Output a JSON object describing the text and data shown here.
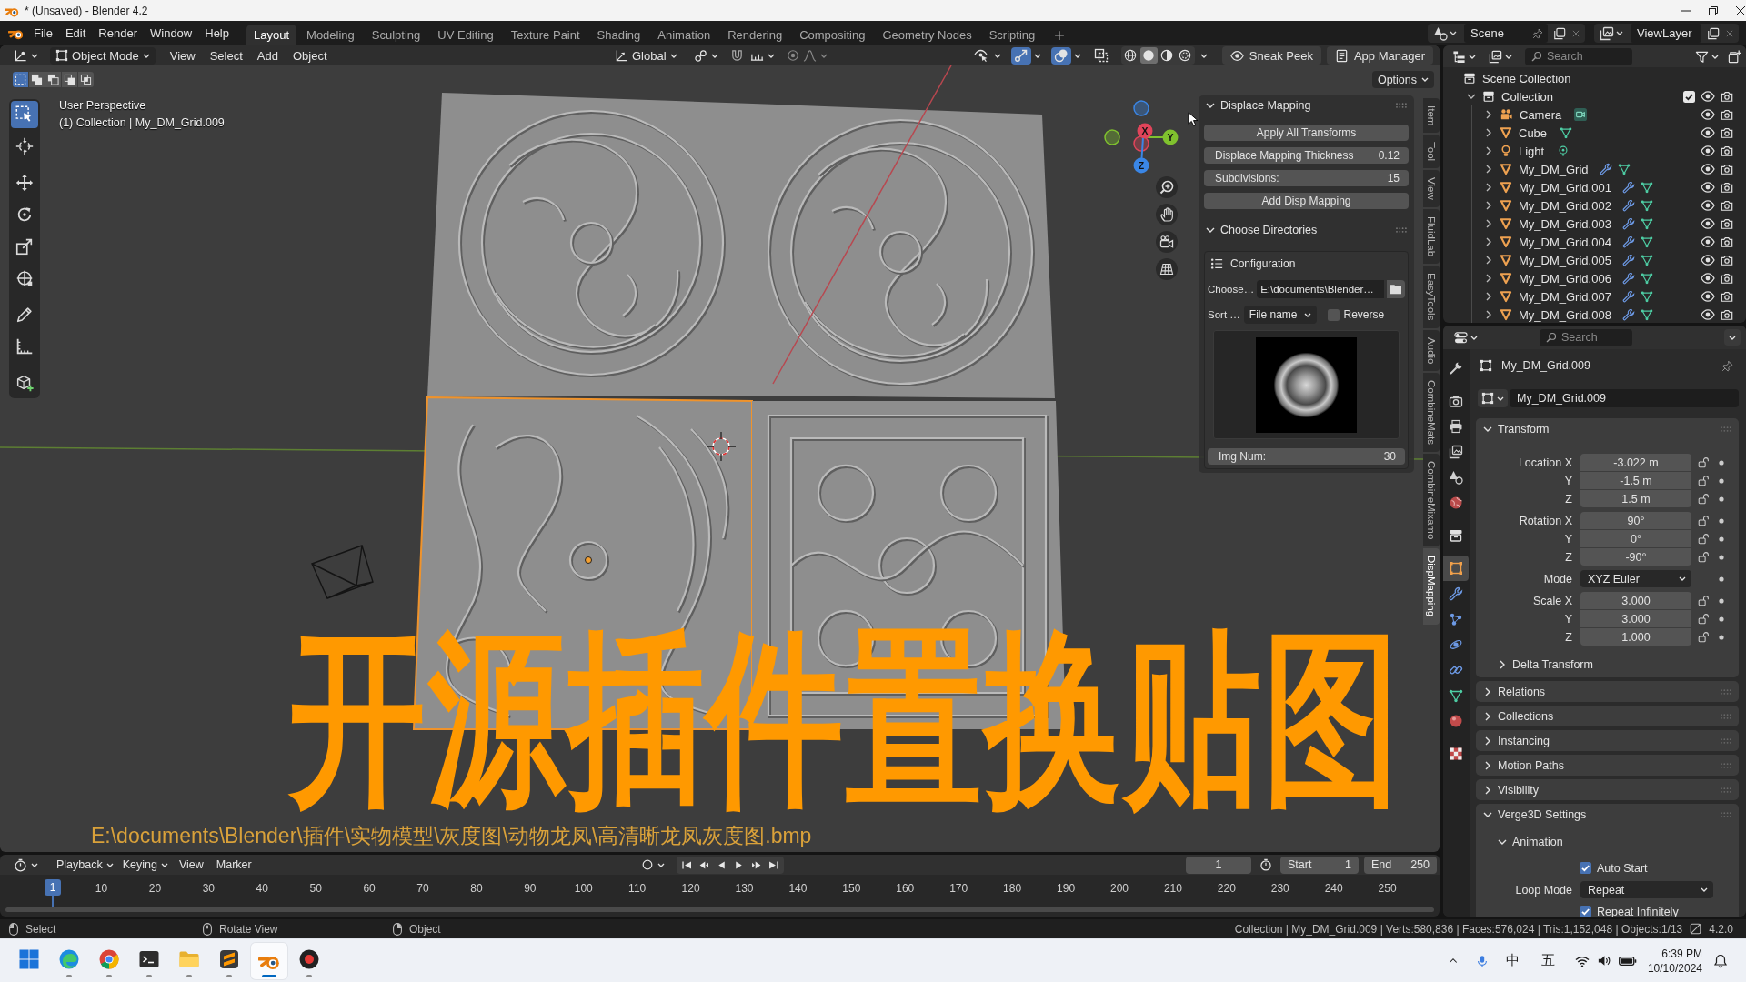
{
  "window": {
    "title": "* (Unsaved) - Blender 4.2"
  },
  "top_bar": {
    "menus": [
      "File",
      "Edit",
      "Render",
      "Window",
      "Help"
    ],
    "workspaces": [
      {
        "label": "Layout",
        "selected": true
      },
      {
        "label": "Modeling",
        "selected": false
      },
      {
        "label": "Sculpting",
        "selected": false
      },
      {
        "label": "UV Editing",
        "selected": false
      },
      {
        "label": "Texture Paint",
        "selected": false
      },
      {
        "label": "Shading",
        "selected": false
      },
      {
        "label": "Animation",
        "selected": false
      },
      {
        "label": "Rendering",
        "selected": false
      },
      {
        "label": "Compositing",
        "selected": false
      },
      {
        "label": "Geometry Nodes",
        "selected": false
      },
      {
        "label": "Scripting",
        "selected": false
      }
    ],
    "scene": "Scene",
    "view_layer": "ViewLayer"
  },
  "viewport": {
    "header": {
      "mode": "Object Mode",
      "menus": [
        "View",
        "Select",
        "Add",
        "Object"
      ],
      "orientation": "Global",
      "toggles": [
        {
          "kind": "visibility",
          "on": false
        },
        {
          "kind": "gizmos",
          "on": true
        },
        {
          "kind": "overlays",
          "on": true
        },
        {
          "kind": "xray",
          "on": false
        }
      ],
      "shading": [
        {
          "kind": "wireframe",
          "selected": false
        },
        {
          "kind": "solid",
          "selected": true
        },
        {
          "kind": "material",
          "selected": false
        },
        {
          "kind": "rendered",
          "selected": false
        }
      ],
      "buttons": [
        {
          "kind": "eye",
          "label": "Sneak Peek"
        },
        {
          "kind": "document",
          "label": "App Manager"
        }
      ]
    },
    "select_modes": [
      {
        "selected": true
      },
      {
        "selected": false
      },
      {
        "selected": false
      },
      {
        "selected": false
      },
      {
        "selected": false
      }
    ],
    "options": "Options",
    "tool_groups": [
      [
        {
          "kind": "select_box",
          "selected": true
        },
        {
          "kind": "cursor",
          "selected": false
        }
      ],
      [
        {
          "kind": "move",
          "selected": false
        },
        {
          "kind": "rotate",
          "selected": false
        },
        {
          "kind": "scale",
          "selected": false
        },
        {
          "kind": "transform",
          "selected": false
        }
      ],
      [
        {
          "kind": "annotate",
          "selected": false
        },
        {
          "kind": "measure",
          "selected": false
        }
      ],
      [
        {
          "kind": "add_cube",
          "selected": false
        }
      ]
    ],
    "view_info": [
      "User Perspective",
      "(1) Collection | My_DM_Grid.009"
    ],
    "relief_panels": [
      {
        "selected": false
      },
      {
        "selected": false
      },
      {
        "selected": true
      },
      {
        "selected": false
      }
    ],
    "gizmo_axes": [
      {
        "label": "X",
        "color": "#e0445a"
      },
      {
        "label": "Y",
        "color": "#80c22e"
      },
      {
        "label": "Z",
        "color": "#3a86e6"
      }
    ],
    "sidebar_tabs": [
      {
        "label": "Item",
        "selected": false
      },
      {
        "label": "Tool",
        "selected": false
      },
      {
        "label": "View",
        "selected": false
      },
      {
        "label": "FluidLab",
        "selected": false
      },
      {
        "label": "EasyTools",
        "selected": false
      },
      {
        "label": "Audio",
        "selected": false
      },
      {
        "label": "CombineMats",
        "selected": false
      },
      {
        "label": "CombineMixamo",
        "selected": false
      },
      {
        "label": "DispMapping",
        "selected": true
      }
    ],
    "sidebar": {
      "panels": [
        {
          "title": "Displace Mapping",
          "expanded": true,
          "items": [
            {
              "kind": "button",
              "label": "Apply All Transforms"
            },
            {
              "kind": "number",
              "label": "Displace Mapping Thickness",
              "value": "0.12"
            },
            {
              "kind": "number",
              "label": "Subdivisions:",
              "value": "15"
            },
            {
              "kind": "button",
              "label": "Add Disp Mapping"
            }
          ]
        },
        {
          "title": "Choose Directories",
          "expanded": true,
          "box": {
            "title": "Configuration",
            "choose_label": "Choose…",
            "path": "E:\\documents\\Blender…",
            "sort_label": "Sort …",
            "sort_value": "File name",
            "reverse_label": "Reverse",
            "reverse_checked": false,
            "img_num_label": "Img Num:",
            "img_num": "30"
          }
        }
      ]
    },
    "caption": "开源插件置换贴图",
    "file_path": "E:\\documents\\Blender\\插件\\实物模型\\灰度图\\动物龙凤\\高清晰龙凤灰度图.bmp"
  },
  "outliner": {
    "search_placeholder": "Search",
    "tree": [
      {
        "name": "Scene Collection",
        "kind": "scene_collection",
        "children": [
          {
            "name": "Collection",
            "kind": "collection",
            "expanded": true,
            "checked": true,
            "children": [
              {
                "name": "Camera",
                "kind": "camera",
                "expanded": false,
                "modifier": false
              },
              {
                "name": "Cube",
                "kind": "mesh",
                "expanded": false,
                "modifier": false
              },
              {
                "name": "Light",
                "kind": "light",
                "expanded": false,
                "modifier": false
              },
              {
                "name": "My_DM_Grid",
                "kind": "mesh",
                "expanded": false,
                "modifier": true
              },
              {
                "name": "My_DM_Grid.001",
                "kind": "mesh",
                "expanded": false,
                "modifier": true
              },
              {
                "name": "My_DM_Grid.002",
                "kind": "mesh",
                "expanded": false,
                "modifier": true
              },
              {
                "name": "My_DM_Grid.003",
                "kind": "mesh",
                "expanded": false,
                "modifier": true
              },
              {
                "name": "My_DM_Grid.004",
                "kind": "mesh",
                "expanded": false,
                "modifier": true
              },
              {
                "name": "My_DM_Grid.005",
                "kind": "mesh",
                "expanded": false,
                "modifier": true
              },
              {
                "name": "My_DM_Grid.006",
                "kind": "mesh",
                "expanded": false,
                "modifier": true
              },
              {
                "name": "My_DM_Grid.007",
                "kind": "mesh",
                "expanded": false,
                "modifier": true
              },
              {
                "name": "My_DM_Grid.008",
                "kind": "mesh",
                "expanded": false,
                "modifier": true
              }
            ]
          }
        ]
      }
    ]
  },
  "properties": {
    "search_placeholder": "Search",
    "tab_groups": [
      [
        {
          "kind": "tool",
          "selected": false
        }
      ],
      [
        {
          "kind": "render",
          "selected": false
        },
        {
          "kind": "output",
          "selected": false
        },
        {
          "kind": "view_layer",
          "selected": false
        },
        {
          "kind": "scene",
          "selected": false
        },
        {
          "kind": "world",
          "selected": false
        }
      ],
      [
        {
          "kind": "collection",
          "selected": false
        }
      ],
      [
        {
          "kind": "object",
          "selected": true
        },
        {
          "kind": "modifiers",
          "selected": false
        },
        {
          "kind": "particles",
          "selected": false
        },
        {
          "kind": "physics",
          "selected": false
        },
        {
          "kind": "constraints",
          "selected": false
        },
        {
          "kind": "data",
          "selected": false
        },
        {
          "kind": "material",
          "selected": false
        }
      ],
      [
        {
          "kind": "texture",
          "selected": false
        }
      ]
    ],
    "object_name": "My_DM_Grid.009",
    "name_field": "My_DM_Grid.009",
    "panels": [
      {
        "title": "Transform",
        "expanded": true,
        "groups": [
          [
            {
              "kind": "number",
              "label": "Location X",
              "value": "-3.022 m"
            },
            {
              "kind": "number",
              "label": "Y",
              "value": "-1.5 m"
            },
            {
              "kind": "number",
              "label": "Z",
              "value": "1.5 m"
            }
          ],
          [
            {
              "kind": "number",
              "label": "Rotation X",
              "value": "90°"
            },
            {
              "kind": "number",
              "label": "Y",
              "value": "0°"
            },
            {
              "kind": "number",
              "label": "Z",
              "value": "-90°"
            }
          ],
          [
            {
              "kind": "dropdown",
              "label": "Mode",
              "value": "XYZ Euler"
            }
          ],
          [
            {
              "kind": "number",
              "label": "Scale X",
              "value": "3.000"
            },
            {
              "kind": "number",
              "label": "Y",
              "value": "3.000"
            },
            {
              "kind": "number",
              "label": "Z",
              "value": "1.000"
            }
          ]
        ],
        "subpanels": [
          {
            "title": "Delta Transform",
            "expanded": false
          }
        ]
      },
      {
        "title": "Relations",
        "expanded": false
      },
      {
        "title": "Collections",
        "expanded": false
      },
      {
        "title": "Instancing",
        "expanded": false
      },
      {
        "title": "Motion Paths",
        "expanded": false
      },
      {
        "title": "Visibility",
        "expanded": false
      },
      {
        "title": "Verge3D Settings",
        "expanded": true,
        "subpanels": [
          {
            "title": "Animation",
            "expanded": true,
            "groups": [
              [
                {
                  "kind": "checkbox",
                  "label": "Auto Start",
                  "checked": true
                }
              ],
              [
                {
                  "kind": "dropdown",
                  "label": "Loop Mode",
                  "value": "Repeat"
                }
              ],
              [
                {
                  "kind": "checkbox",
                  "label": "Repeat Infinitely",
                  "checked": true
                }
              ]
            ]
          }
        ]
      }
    ]
  },
  "timeline": {
    "menus": [
      {
        "kind": "dropdown",
        "label": "Playback"
      },
      {
        "kind": "dropdown",
        "label": "Keying"
      },
      {
        "kind": "menu",
        "label": "View"
      },
      {
        "kind": "menu",
        "label": "Marker"
      }
    ],
    "frame": "1",
    "start_label": "Start",
    "start": "1",
    "end_label": "End",
    "end": "250",
    "playhead": "1",
    "ruler": [
      "10",
      "20",
      "30",
      "40",
      "50",
      "60",
      "70",
      "80",
      "90",
      "100",
      "110",
      "120",
      "130",
      "140",
      "150",
      "160",
      "170",
      "180",
      "190",
      "200",
      "210",
      "220",
      "230",
      "240",
      "250"
    ]
  },
  "status_bar": {
    "hints": [
      {
        "kind": "left",
        "label": "Select"
      },
      {
        "kind": "middle",
        "label": "Rotate View"
      },
      {
        "kind": "right",
        "label": "Object"
      }
    ],
    "stats": "Collection | My_DM_Grid.009 | Verts:580,836 | Faces:576,024 | Tris:1,152,048 | Objects:1/13",
    "version": "4.2.0"
  },
  "taskbar": {
    "apps": [
      {
        "kind": "start",
        "selected": false,
        "running": false
      },
      {
        "kind": "edge",
        "selected": false,
        "running": true
      },
      {
        "kind": "chrome",
        "selected": false,
        "running": true
      },
      {
        "kind": "terminal",
        "selected": false,
        "running": true
      },
      {
        "kind": "files",
        "selected": false,
        "running": true
      },
      {
        "kind": "sublime",
        "selected": false,
        "running": true
      },
      {
        "kind": "blender",
        "selected": true,
        "running": true
      },
      {
        "kind": "recorder",
        "selected": false,
        "running": true
      }
    ],
    "tray_texts": [
      "中",
      "五"
    ],
    "time": "6:39 PM",
    "date": "10/10/2024"
  }
}
